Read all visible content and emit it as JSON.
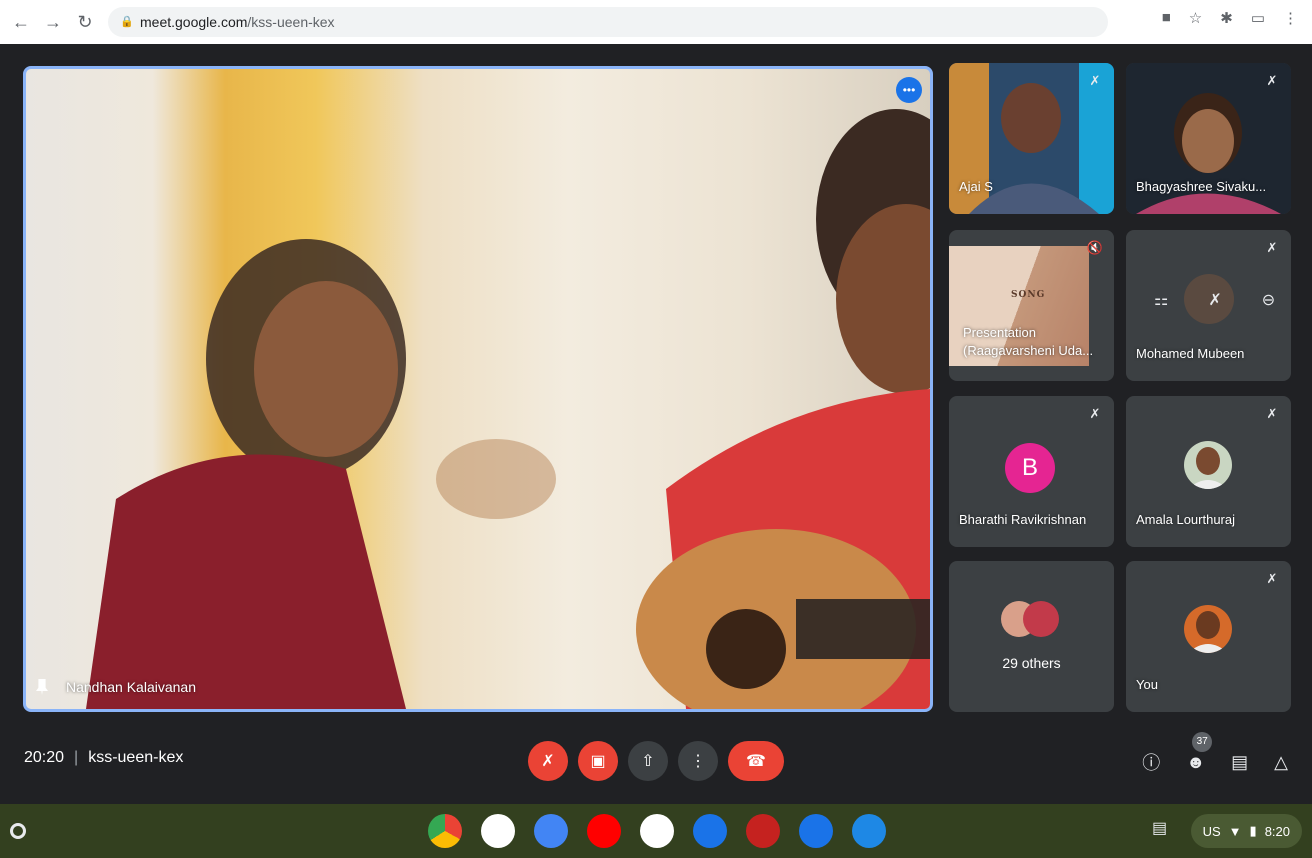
{
  "browser": {
    "url_host": "meet.google.com",
    "url_path": "/kss-ueen-kex",
    "back_icon": "arrow-left-icon",
    "forward_icon": "arrow-right-icon",
    "reload_icon": "reload-icon"
  },
  "main_video": {
    "name": "Nandhan Kalaivanan"
  },
  "tiles": [
    {
      "name": "Ajai S"
    },
    {
      "name": "Bhagyashree Sivaku..."
    },
    {
      "name_line1": "Presentation",
      "name_line2": "(Raagavarsheni Uda...",
      "slide_text": "SONG"
    },
    {
      "name": "Mohamed Mubeen"
    },
    {
      "name": "Bharathi Ravikrishnan",
      "avatar_letter": "B"
    },
    {
      "name": "Amala Lourthuraj"
    },
    {
      "others": "29 others"
    },
    {
      "name": "You"
    }
  ],
  "meeting": {
    "time": "20:20",
    "separator": "|",
    "code": "kss-ueen-kex",
    "participants_count": "37"
  },
  "shelf": {
    "locale": "US",
    "clock": "8:20"
  },
  "colors": {
    "accent_blue": "#1a73e8",
    "danger_red": "#ea4335",
    "tile_bg": "#3c4043",
    "meet_bg": "#202124",
    "avatar_pink": "#e52592"
  }
}
